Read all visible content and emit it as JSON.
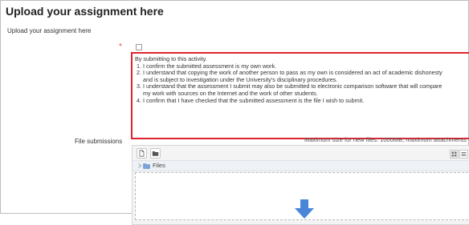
{
  "header": {
    "title": "Upload your assignment here",
    "subtitle": "Upload your assignment here"
  },
  "declaration": {
    "required_marker": "*",
    "intro": "By submitting to this activity.",
    "items": [
      "I confirm the submitted assessment is my own work.",
      "I understand that copying the work of another person to pass as my own is considered an act of academic dishonesty",
      "and is subject to investigation under the University’s disciplinary procedures.",
      "I understand that the assessment I submit may also be submitted to electronic comparison software that will compare",
      "my work with sources on the Internet and the work of other students.",
      "I confirm that I have checked that the submitted assessment is the file I wish to submit."
    ]
  },
  "file_submissions": {
    "label": "File submissions",
    "max_size_text": "Maximum size for new files: 1000MB, maximum attachments",
    "breadcrumb_label": "Files",
    "drop_icon": "down-arrow-icon"
  },
  "colors": {
    "highlight_border": "#e0242f",
    "drop_arrow": "#4a86d8",
    "folder": "#7aa3d8"
  }
}
